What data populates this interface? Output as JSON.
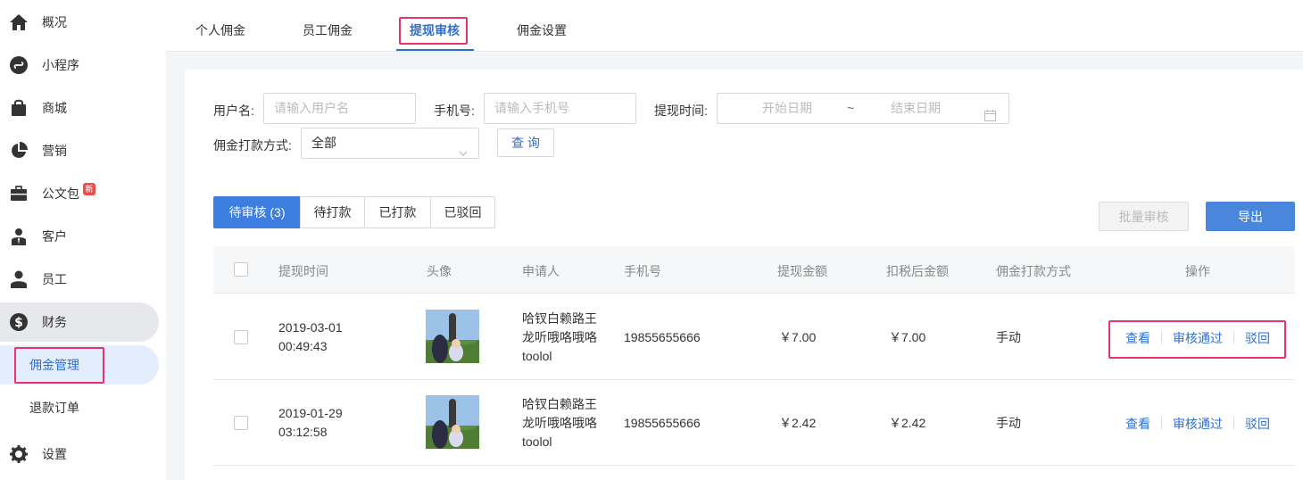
{
  "sidebar": {
    "items": [
      {
        "label": "概况",
        "icon": "home-icon"
      },
      {
        "label": "小程序",
        "icon": "mini-program-icon"
      },
      {
        "label": "商城",
        "icon": "shopping-bag-icon"
      },
      {
        "label": "营销",
        "icon": "pie-chart-icon"
      },
      {
        "label": "公文包",
        "icon": "briefcase-icon",
        "badge": "新"
      },
      {
        "label": "客户",
        "icon": "customer-icon"
      },
      {
        "label": "员工",
        "icon": "user-icon"
      },
      {
        "label": "财务",
        "icon": "dollar-icon"
      },
      {
        "label": "设置",
        "icon": "gear-icon"
      }
    ],
    "sub_items": [
      {
        "label": "佣金管理"
      },
      {
        "label": "退款订单"
      }
    ]
  },
  "tabs": [
    "个人佣金",
    "员工佣金",
    "提现审核",
    "佣金设置"
  ],
  "filters": {
    "username_label": "用户名:",
    "username_placeholder": "请输入用户名",
    "phone_label": "手机号:",
    "phone_placeholder": "请输入手机号",
    "time_label": "提现时间:",
    "start_placeholder": "开始日期",
    "range_sep": "~",
    "end_placeholder": "结束日期",
    "method_label": "佣金打款方式:",
    "method_value": "全部",
    "query_button": "查 询"
  },
  "status_tabs": [
    "待审核 (3)",
    "待打款",
    "已打款",
    "已驳回"
  ],
  "actions": {
    "batch": "批量审核",
    "export": "导出"
  },
  "table": {
    "columns": [
      "提现时间",
      "头像",
      "申请人",
      "手机号",
      "提现金额",
      "扣税后金额",
      "佣金打款方式",
      "操作"
    ],
    "rows": [
      {
        "date": "2019-03-01",
        "time": "00:49:43",
        "applicant1": "哈钗白赖路王",
        "applicant2": "龙听哦咯哦咯",
        "applicant3": "toolol",
        "phone": "19855655666",
        "amount": "￥7.00",
        "after_tax": "￥7.00",
        "method": "手动"
      },
      {
        "date": "2019-01-29",
        "time": "03:12:58",
        "applicant1": "哈钗白赖路王",
        "applicant2": "龙听哦咯哦咯",
        "applicant3": "toolol",
        "phone": "19855655666",
        "amount": "￥2.42",
        "after_tax": "￥2.42",
        "method": "手动"
      }
    ],
    "ops": {
      "view": "查看",
      "approve": "审核通过",
      "reject": "驳回"
    }
  },
  "colors": {
    "accent": "#3d7ee0",
    "highlight": "#e8336d",
    "badge": "#f04b4b"
  }
}
